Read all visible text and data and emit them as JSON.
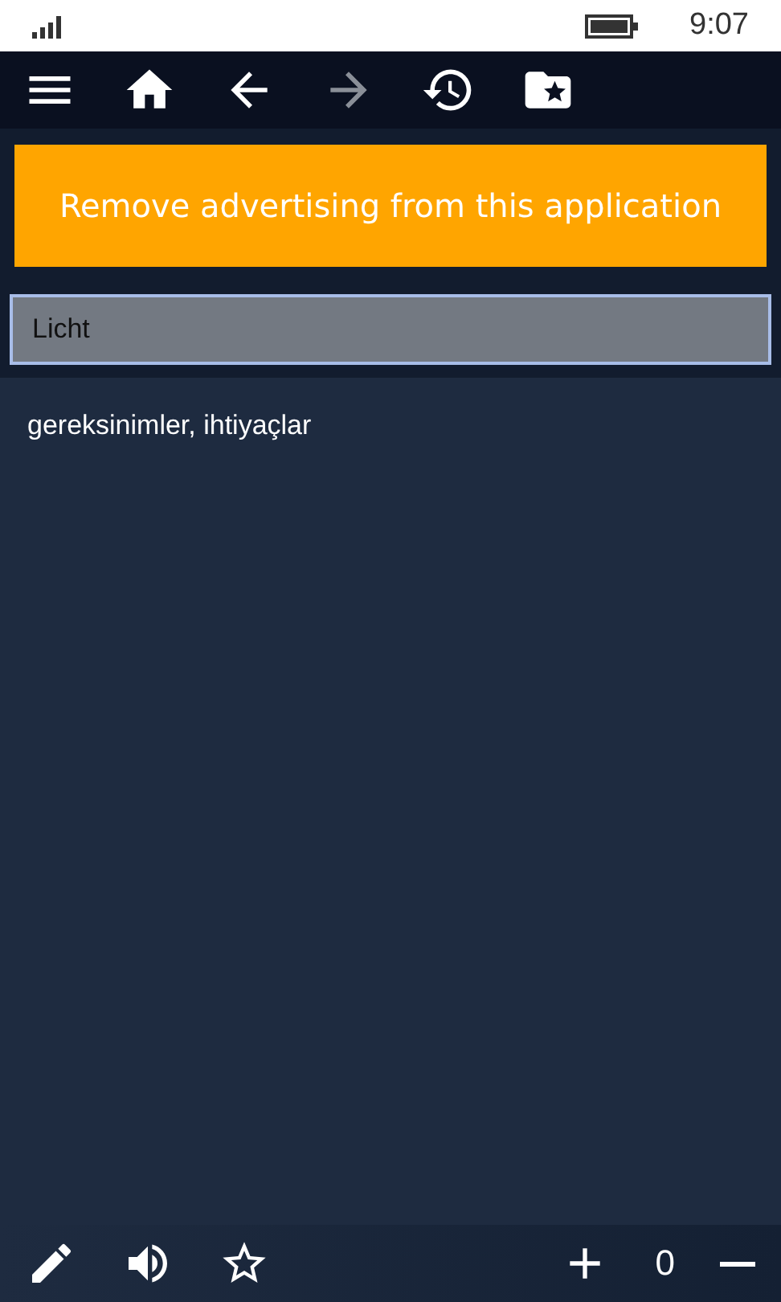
{
  "status_bar": {
    "time": "9:07"
  },
  "toolbar": [
    {
      "kind": "menu",
      "disabled": false
    },
    {
      "kind": "home",
      "disabled": false
    },
    {
      "kind": "back",
      "disabled": false
    },
    {
      "kind": "forward",
      "disabled": true
    },
    {
      "kind": "history",
      "disabled": false
    },
    {
      "kind": "favorites",
      "disabled": false
    }
  ],
  "banner": {
    "text": "Remove advertising from this application"
  },
  "search": {
    "value": "Licht"
  },
  "translation": "gereksinimler, ihtiyaçlar",
  "bottom_bar": {
    "actions": [
      {
        "kind": "edit"
      },
      {
        "kind": "speak"
      },
      {
        "kind": "favorite"
      }
    ],
    "counter": "0"
  }
}
